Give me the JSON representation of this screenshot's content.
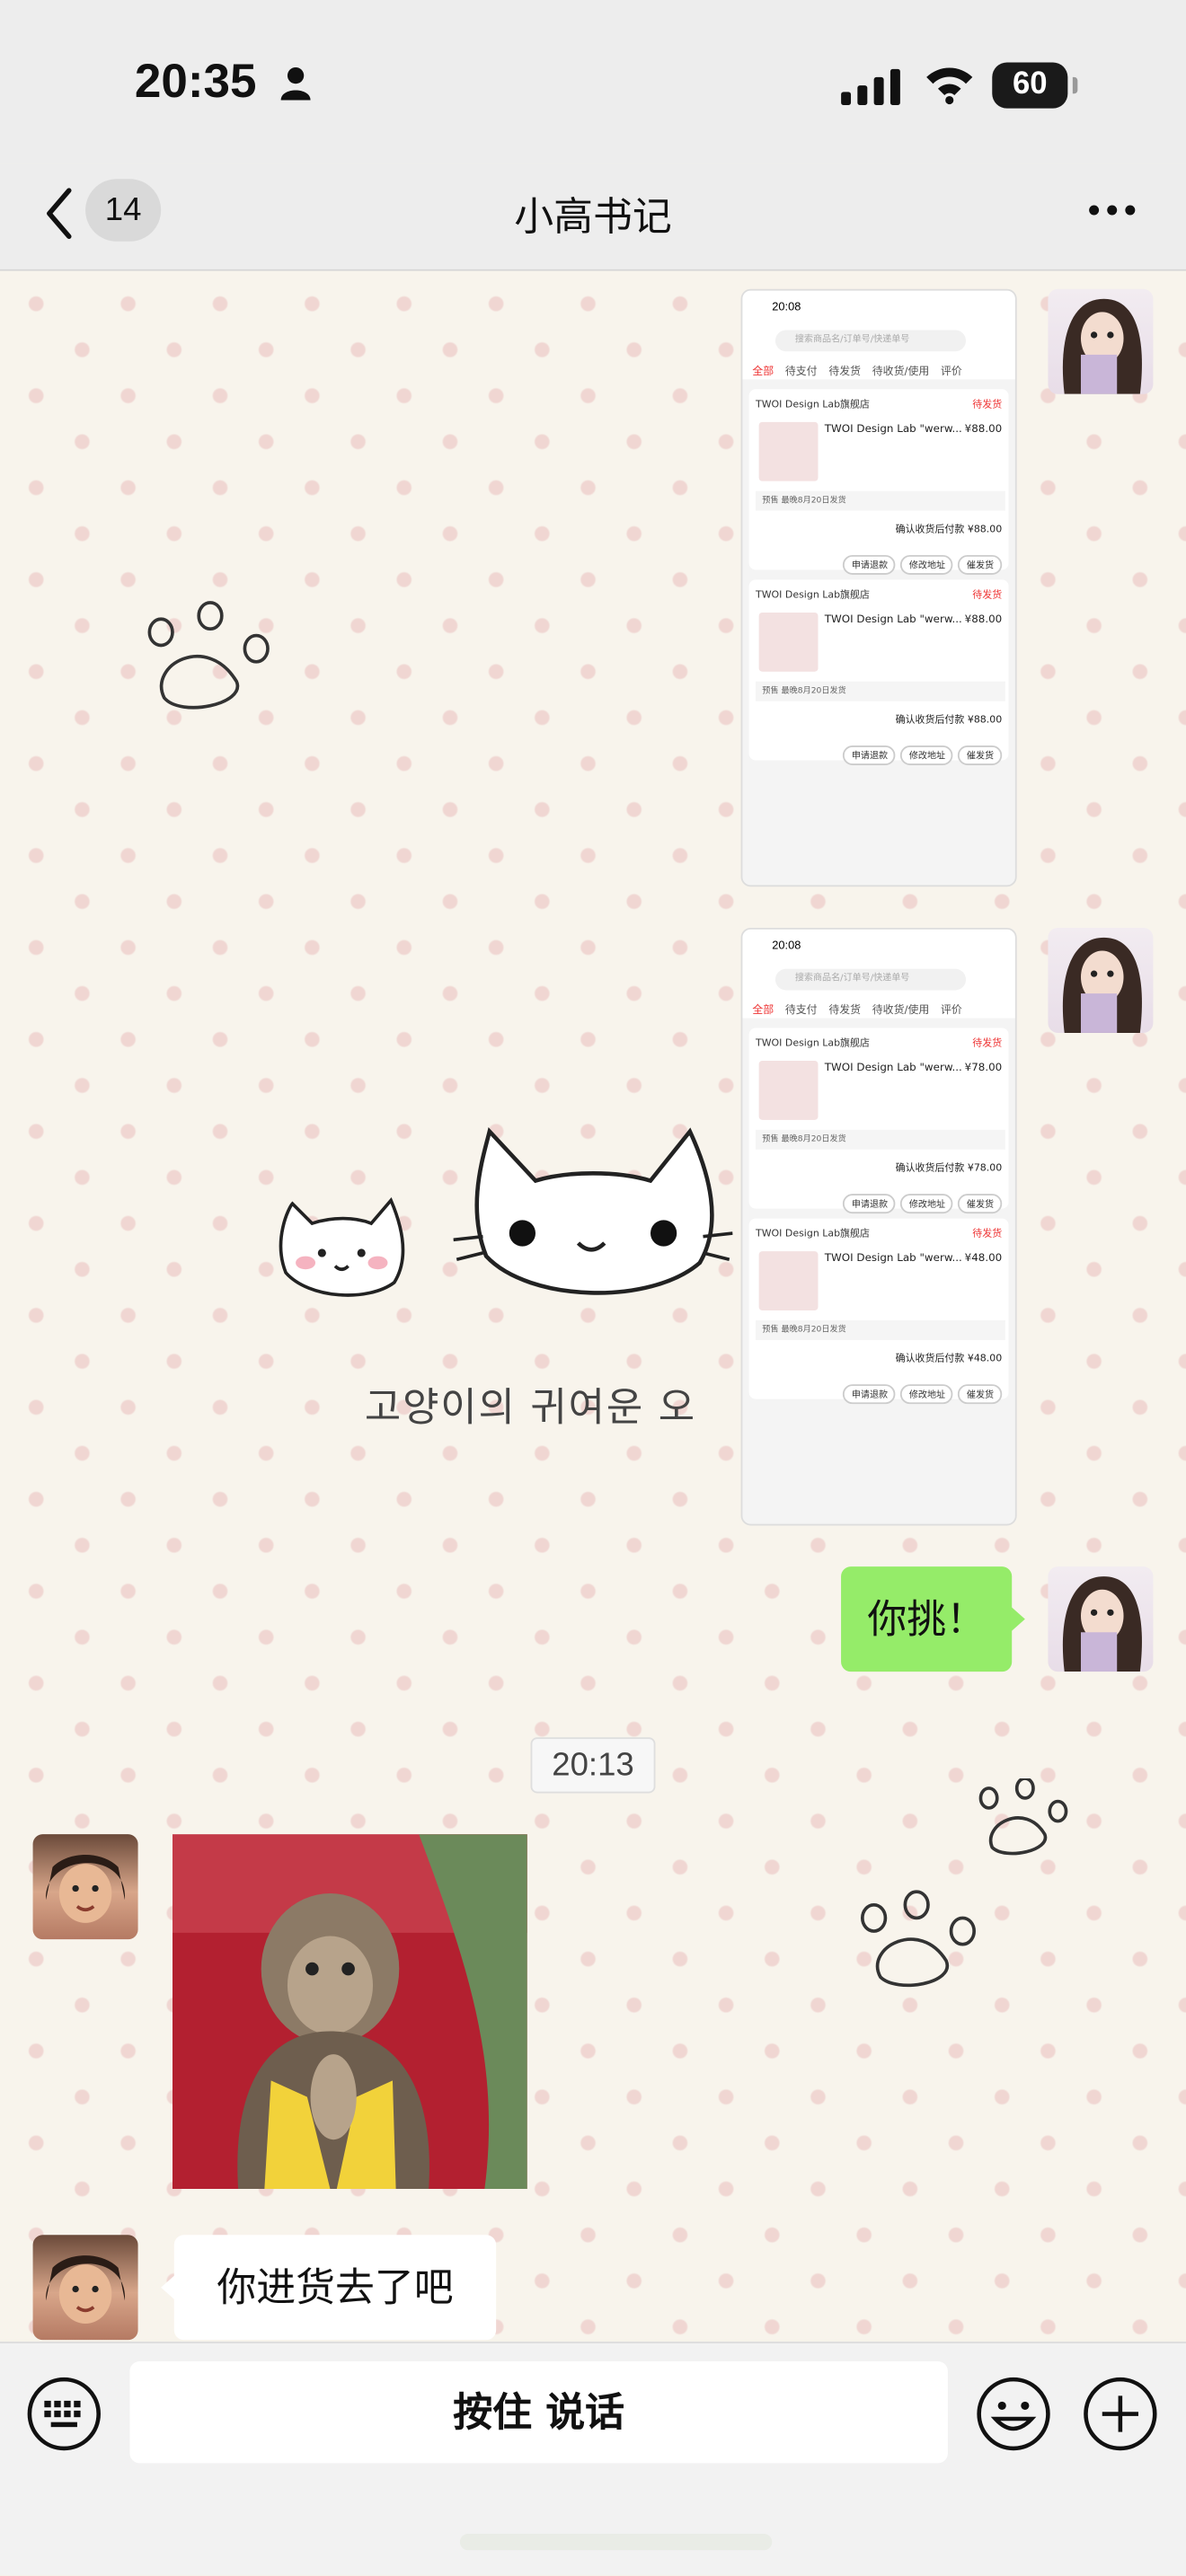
{
  "status_bar": {
    "time": "20:35",
    "battery": "60",
    "icons": [
      "person-icon",
      "signal-icon",
      "wifi-icon",
      "battery-icon"
    ]
  },
  "nav": {
    "back_icon": "chevron-left-icon",
    "unread_count": "14",
    "title": "小高书记",
    "more_icon": "ellipsis-icon"
  },
  "messages": {
    "screenshot_1": {
      "time": "20:08",
      "search_placeholder": "搜索商品名/订单号/快递单号",
      "tabs": [
        "全部",
        "待支付",
        "待发货",
        "待收货/使用",
        "评价"
      ],
      "orders": [
        {
          "shop": "TWOI Design Lab旗舰店",
          "status": "待发货",
          "product": "TWOI Design Lab \"werw...",
          "price": "¥88.00",
          "presale": "预售  最晚8月20日发货",
          "total": "确认收货后付款 ¥88.00",
          "buttons": [
            "申请退款",
            "修改地址",
            "催发货"
          ]
        },
        {
          "shop": "TWOI Design Lab旗舰店",
          "status": "待发货",
          "product": "TWOI Design Lab \"werw...",
          "price": "¥88.00",
          "presale": "预售  最晚8月20日发货",
          "total": "确认收货后付款 ¥88.00",
          "buttons": [
            "申请退款",
            "修改地址",
            "催发货"
          ]
        }
      ]
    },
    "screenshot_2": {
      "time": "20:08",
      "search_placeholder": "搜索商品名/订单号/快递单号",
      "tabs": [
        "全部",
        "待支付",
        "待发货",
        "待收货/使用",
        "评价"
      ],
      "orders": [
        {
          "shop": "TWOI Design Lab旗舰店",
          "status": "待发货",
          "product": "TWOI Design Lab \"werw...",
          "price": "¥78.00",
          "presale": "预售  最晚8月20日发货",
          "total": "确认收货后付款 ¥78.00",
          "buttons": [
            "申请退款",
            "修改地址",
            "催发货"
          ]
        },
        {
          "shop": "TWOI Design Lab旗舰店",
          "status": "待发货",
          "product": "TWOI Design Lab \"werw...",
          "price": "¥48.00",
          "presale": "预售  最晚8月20日发货",
          "total": "确认收货后付款 ¥48.00",
          "buttons": [
            "申请退款",
            "修改地址",
            "催发货"
          ]
        }
      ]
    },
    "sent_text": "你挑！",
    "timestamp": "20:13",
    "received_text": "你进货去了吧"
  },
  "background": {
    "caption": "고양이의 귀여운 오"
  },
  "input_bar": {
    "voice_label": "按住 说话",
    "icons": [
      "keyboard-icon",
      "emoji-icon",
      "plus-icon"
    ]
  }
}
